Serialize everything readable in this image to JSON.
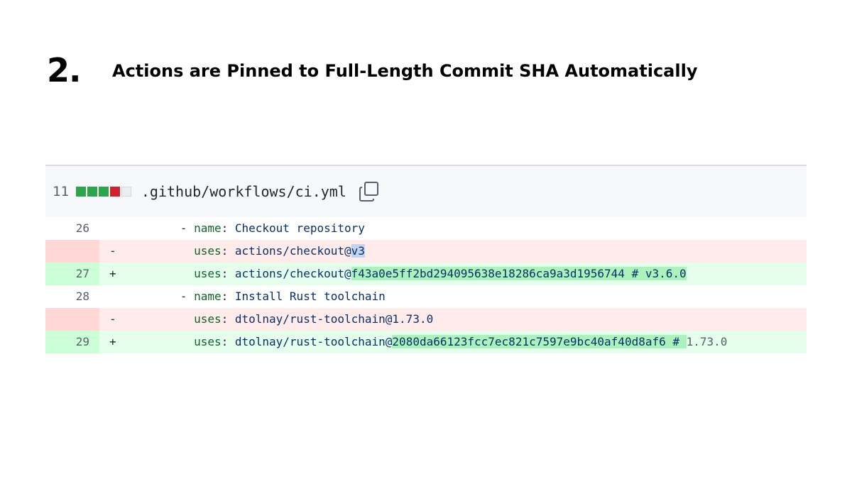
{
  "slide": {
    "number": "2.",
    "title": "Actions are Pinned to Full-Length Commit SHA Automatically"
  },
  "file": {
    "change_count": "11",
    "diffstat": [
      "add",
      "add",
      "add",
      "del",
      "neutral"
    ],
    "path": ".github/workflows/ci.yml",
    "copy_icon": "copy-icon"
  },
  "diff": {
    "rows": [
      {
        "type": "ctx",
        "line": "26",
        "marker": "",
        "indent": "      ",
        "dash": "- ",
        "key": "name",
        "value": "Checkout repository"
      },
      {
        "type": "del",
        "line": "",
        "marker": "-",
        "indent": "        ",
        "key": "uses",
        "prefix": "actions/checkout@",
        "highlight": "v3",
        "suffix": ""
      },
      {
        "type": "add",
        "line": "27",
        "marker": "+",
        "indent": "        ",
        "key": "uses",
        "prefix": "actions/checkout@",
        "highlight": "f43a0e5ff2bd294095638e18286ca9a3d1956744 # v3.6.0",
        "suffix": ""
      },
      {
        "type": "ctx",
        "line": "28",
        "marker": "",
        "indent": "      ",
        "dash": "- ",
        "key": "name",
        "value": "Install Rust toolchain"
      },
      {
        "type": "del",
        "line": "",
        "marker": "-",
        "indent": "        ",
        "key": "uses",
        "prefix": "dtolnay/rust-toolchain@1.73.0",
        "highlight": "",
        "suffix": ""
      },
      {
        "type": "add",
        "line": "29",
        "marker": "+",
        "indent": "        ",
        "key": "uses",
        "prefix": "dtolnay/rust-toolchain@",
        "highlight": "2080da66123fcc7ec821c7597e9bc40af40d8af6 # ",
        "suffix": "1.73.0"
      }
    ]
  }
}
